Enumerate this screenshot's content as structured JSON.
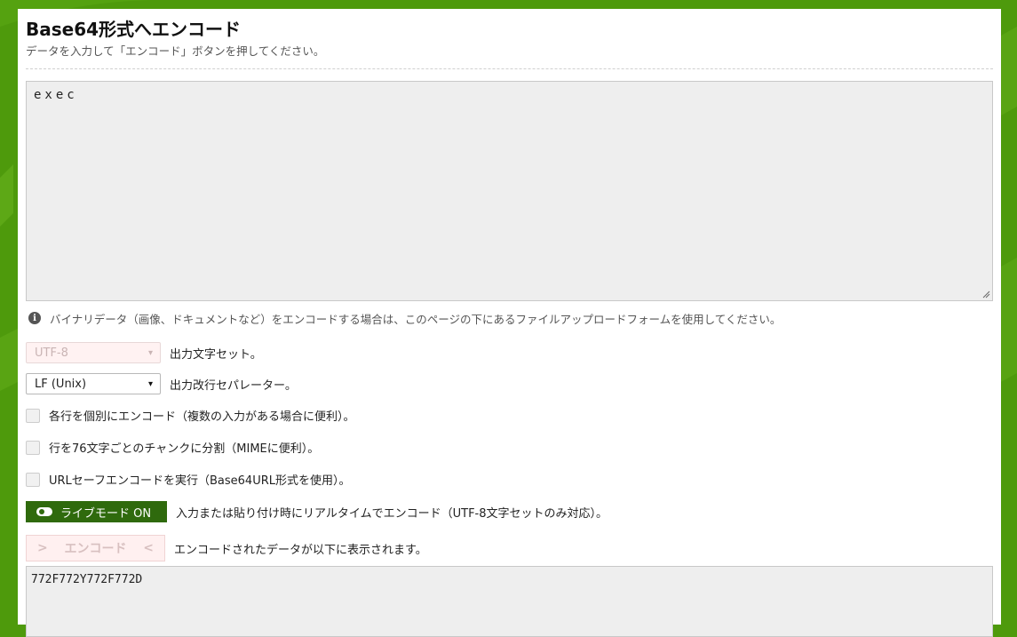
{
  "header": {
    "title": "Base64形式へエンコード",
    "subtitle": "データを入力して「エンコード」ボタンを押してください。"
  },
  "input": {
    "value": "exec"
  },
  "info": {
    "icon": "info-icon",
    "text": "バイナリデータ（画像、ドキュメントなど）をエンコードする場合は、このページの下にあるファイルアップロードフォームを使用してください。"
  },
  "options": {
    "charset": {
      "value": "UTF-8",
      "label": "出力文字セット。"
    },
    "newline": {
      "value": "LF (Unix)",
      "label": "出力改行セパレーター。"
    },
    "each_line": {
      "label": "各行を個別にエンコード（複数の入力がある場合に便利）。",
      "checked": false
    },
    "chunks": {
      "label": "行を76文字ごとのチャンクに分割（MIMEに便利）。",
      "checked": false
    },
    "url_safe": {
      "label": "URLセーフエンコードを実行（Base64URL形式を使用）。",
      "checked": false
    }
  },
  "live": {
    "button_label": "ライブモード ON",
    "description": "入力または貼り付け時にリアルタイムでエンコード（UTF-8文字セットのみ対応）。"
  },
  "encode": {
    "button_label": "エンコード",
    "description": "エンコードされたデータが以下に表示されます。"
  },
  "output": {
    "value": "772F772Y772F772D"
  },
  "colors": {
    "background": "#4e9a0c",
    "live_button": "#2f6a0d",
    "encode_button_disabled": "#fff0f0"
  }
}
